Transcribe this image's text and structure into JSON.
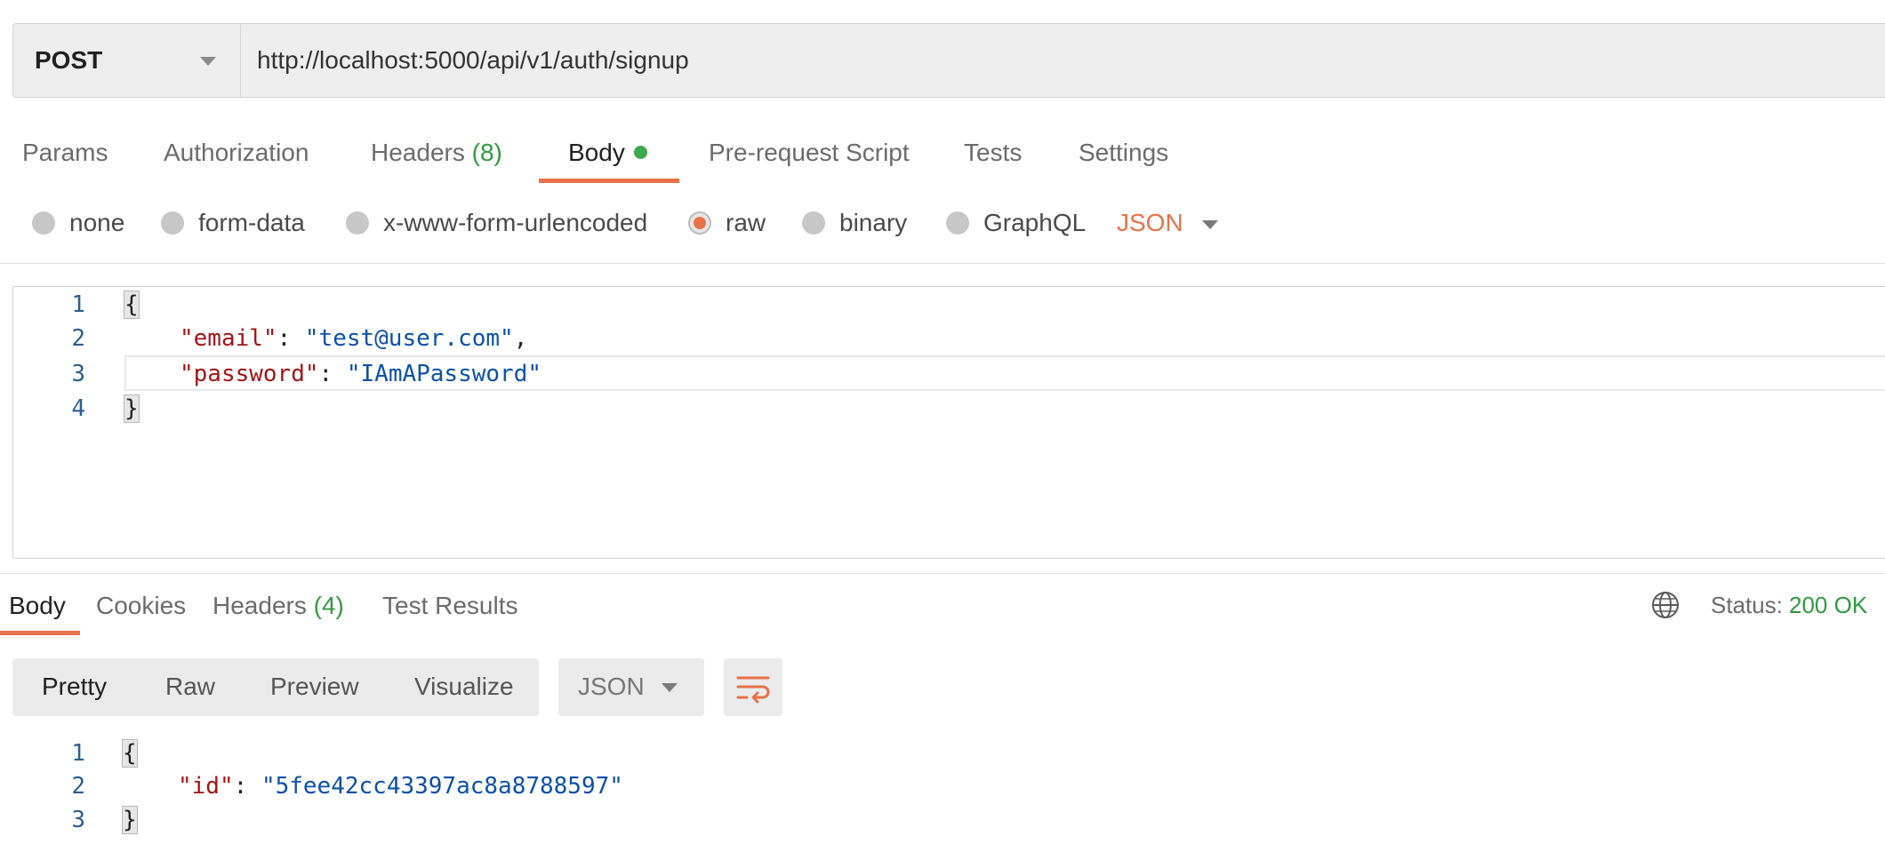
{
  "request": {
    "method": "POST",
    "url": "http://localhost:5000/api/v1/auth/signup"
  },
  "request_tabs": {
    "params": "Params",
    "authorization": "Authorization",
    "headers": "Headers",
    "headers_count": "(8)",
    "body": "Body",
    "pre_request": "Pre-request Script",
    "tests": "Tests",
    "settings": "Settings"
  },
  "body_types": {
    "none": "none",
    "form_data": "form-data",
    "urlencoded": "x-www-form-urlencoded",
    "raw": "raw",
    "binary": "binary",
    "graphql": "GraphQL",
    "format": "JSON",
    "selected": "raw"
  },
  "editor": {
    "line_numbers": [
      "1",
      "2",
      "3",
      "4"
    ],
    "open": "{",
    "close": "}",
    "key1": "\"email\"",
    "val1": "\"test@user.com\"",
    "key2": "\"password\"",
    "val2": "\"IAmAPassword\""
  },
  "response_tabs": {
    "body": "Body",
    "cookies": "Cookies",
    "headers": "Headers",
    "headers_count": "(4)",
    "test_results": "Test Results"
  },
  "status": {
    "label": "Status:",
    "value": "200 OK"
  },
  "view_modes": {
    "pretty": "Pretty",
    "raw": "Raw",
    "preview": "Preview",
    "visualize": "Visualize",
    "language": "JSON"
  },
  "response_body": {
    "line_numbers": [
      "1",
      "2",
      "3"
    ],
    "open": "{",
    "close": "}",
    "key": "\"id\"",
    "val": "\"5fee42cc43397ac8a8788597\""
  },
  "colors": {
    "accent": "#e8734a",
    "success": "#2f9b3f",
    "json_key": "#a31515",
    "json_string": "#0b51a8"
  }
}
